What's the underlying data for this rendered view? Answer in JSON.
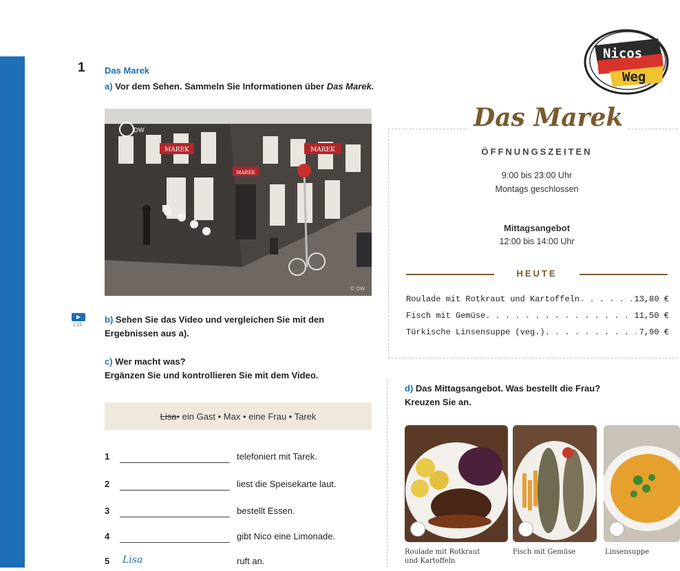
{
  "exercise": {
    "number": "1",
    "title": "Das Marek",
    "task_a_letter": "a)",
    "task_a_text": "Vor dem Sehen. Sammeln Sie Informationen über",
    "task_a_em": "Das Marek.",
    "task_b_letter": "b)",
    "task_b_line1": "Sehen Sie das Video und vergleichen Sie mit den",
    "task_b_line2": "Ergebnissen aus a).",
    "task_c_letter": "c)",
    "task_c_line1": "Wer macht was?",
    "task_c_line2": "Ergänzen Sie und kontrollieren Sie mit dem Video.",
    "video_code": "1.21",
    "photo_label": "DW",
    "photo_credit": "© DW",
    "photo_sign": "MAREK"
  },
  "word_box": {
    "struck": "Lisa",
    "rest": " • ein Gast • Max • eine Frau • Tarek"
  },
  "sentences": [
    {
      "n": "1",
      "given": "",
      "text": "telefoniert mit Tarek."
    },
    {
      "n": "2",
      "given": "",
      "text": " liest die Speisekarte laut."
    },
    {
      "n": "3",
      "given": "",
      "text": "bestellt Essen."
    },
    {
      "n": "4",
      "given": "",
      "text": "gibt Nico eine Limonade."
    },
    {
      "n": "5",
      "given": "Lisa",
      "text": "ruft an."
    }
  ],
  "menu": {
    "title": "Das Marek",
    "subtitle": "ÖFFNUNGSZEITEN",
    "hours": "9:00 bis 23:00 Uhr",
    "closed": "Montags geschlossen",
    "lunch_title": "Mittagsangebot",
    "lunch_hours": "12:00 bis 14:00 Uhr",
    "today": "HEUTE",
    "dishes": [
      {
        "name": "Roulade mit Rotkraut und Kartoffeln",
        "price": "13,80 €"
      },
      {
        "name": "Fisch mit Gemüse",
        "price": "11,50 €"
      },
      {
        "name": "Türkische Linsensuppe (veg.)",
        "price": "7,90 €"
      }
    ]
  },
  "task_d": {
    "letter": "d)",
    "line1": "Das Mittagsangebot. Was bestellt die Frau?",
    "line2": "Kreuzen Sie an.",
    "captions": [
      "Roulade mit Rotkraut",
      "und Kartoffeln",
      "Fisch mit Gemüse",
      "Linsensuppe"
    ]
  },
  "logo": {
    "line1": "Nicos",
    "line2": "Weg"
  },
  "colors": {
    "accent": "#1e6fb8",
    "menu_brown": "#7a5a2e",
    "box_bg": "#efe8dc"
  }
}
